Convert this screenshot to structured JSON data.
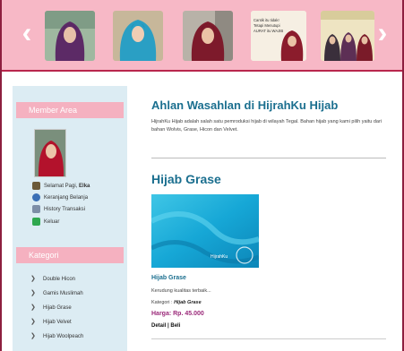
{
  "slider": {
    "prev_icon": "chevron-left-icon",
    "next_icon": "chevron-right-icon",
    "banner_text": "Cantik itu tidak!\nTetapi Menutupi\nAURAT itu WAJIB",
    "banner_logo": "HijrahKu"
  },
  "sidebar": {
    "member_title": "Member Area",
    "greeting": "Selamat Pagi, ",
    "user": "Elka",
    "menu": [
      {
        "label": "Keranjang Belanja",
        "icon": "cart-icon",
        "color": "#3a6fb5"
      },
      {
        "label": "History Transaksi",
        "icon": "history-icon",
        "color": "#7d8ea6"
      },
      {
        "label": "Keluar",
        "icon": "logout-icon",
        "color": "#2fa84f"
      }
    ],
    "category_title": "Kategori",
    "categories": [
      "Double Hicon",
      "Gamis Muslimah",
      "Hijab Grase",
      "Hijab Velvet",
      "Hijab Woolpeach"
    ]
  },
  "main": {
    "title": "Ahlan Wasahlan di HijrahKu Hijab",
    "intro": "HijrahKu Hijab adalah salah satu pemroduksi hijab di wilayah Tegal. Bahan hijab yang kami pilih yaitu dari bahan Wolvis, Grase, Hicon dan Velvet.",
    "section_title": "Hijab Grase",
    "product": {
      "name": "Hijab Grase",
      "description": "Kerudung kualitas terbaik...",
      "category_label": "Kategori : ",
      "category": "Hijab Grase",
      "price": "Harga: Rp. 45.000",
      "detail": "Detail",
      "separator": " | ",
      "buy": "Beli",
      "image_caption": "HijrahKu"
    }
  },
  "colors": {
    "slider_bg": "#f7b8c6",
    "sidebar_bg": "#dcecf3",
    "heading": "#1b6f8f",
    "price": "#9b2a7a",
    "border": "#8d1f3f"
  }
}
